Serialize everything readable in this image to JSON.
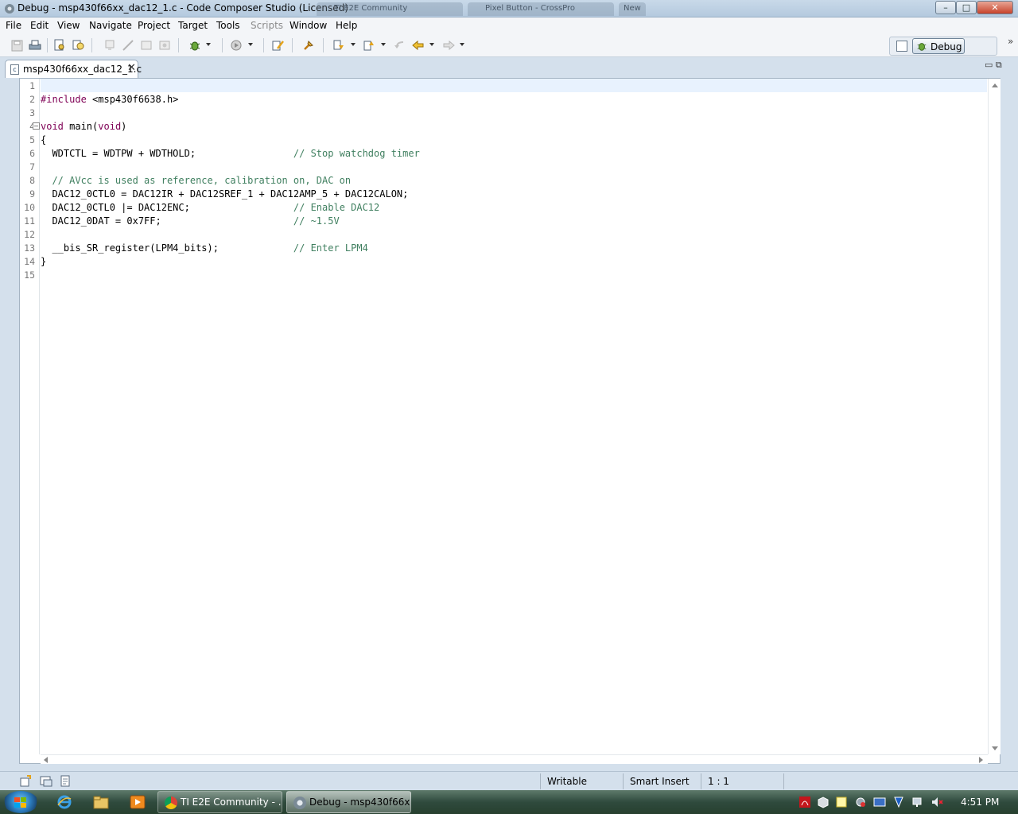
{
  "window": {
    "title": "Debug - msp430f66xx_dac12_1.c - Code Composer Studio (Licensed)",
    "ghost_tabs": [
      "TI E2E Community",
      "Pixel Button - CrossPro",
      "New"
    ],
    "minimize_glyph": "–",
    "maximize_glyph": "□",
    "close_glyph": "✕"
  },
  "menubar": {
    "items": [
      {
        "label": "File",
        "enabled": true
      },
      {
        "label": "Edit",
        "enabled": true
      },
      {
        "label": "View",
        "enabled": true
      },
      {
        "label": "Navigate",
        "enabled": true
      },
      {
        "label": "Project",
        "enabled": true
      },
      {
        "label": "Target",
        "enabled": true
      },
      {
        "label": "Tools",
        "enabled": true
      },
      {
        "label": "Scripts",
        "enabled": false
      },
      {
        "label": "Window",
        "enabled": true
      },
      {
        "label": "Help",
        "enabled": true
      }
    ]
  },
  "toolbar": {
    "icons": [
      "save-icon",
      "print-icon",
      "print-preview-icon",
      "search-files-icon",
      "disconnect-icon",
      "connect-icon",
      "load-program-icon",
      "restart-icon",
      "debug-icon",
      "run-icon",
      "external-tools-icon",
      "pin-icon",
      "next-annotation-icon",
      "previous-annotation-icon",
      "last-edit-icon",
      "back-icon",
      "forward-icon"
    ],
    "perspective_label": "Debug",
    "chevron": "»"
  },
  "editor": {
    "tab_label": "msp430f66xx_dac12_1.c",
    "tab_close": "✕",
    "line_numbers": [
      "1",
      "2",
      "3",
      "4",
      "5",
      "6",
      "7",
      "8",
      "9",
      "10",
      "11",
      "12",
      "13",
      "14",
      "15"
    ],
    "lines": [
      "",
      "#include <msp430f6638.h>",
      "",
      "void main(void)",
      "{",
      "  WDTCTL = WDTPW + WDTHOLD;                 // Stop watchdog timer",
      "",
      "  // AVcc is used as reference, calibration on, DAC on",
      "  DAC12_0CTL0 = DAC12IR + DAC12SREF_1 + DAC12AMP_5 + DAC12CALON;",
      "  DAC12_0CTL0 |= DAC12ENC;                  // Enable DAC12",
      "  DAC12_0DAT = 0x7FF;                       // ~1.5V",
      "",
      "  __bis_SR_register(LPM4_bits);             // Enter LPM4",
      "}",
      ""
    ]
  },
  "statusbar": {
    "writable": "Writable",
    "insert_mode": "Smart Insert",
    "position": "1 : 1"
  },
  "taskbar": {
    "buttons": [
      {
        "label": "TI E2E Community - ...",
        "active": false
      },
      {
        "label": "Debug - msp430f66x...",
        "active": true
      }
    ],
    "clock": "4:51 PM"
  },
  "colors": {
    "keyword": "#7f0055",
    "comment": "#3f7f5f",
    "current_line": "#e8f2fe"
  }
}
